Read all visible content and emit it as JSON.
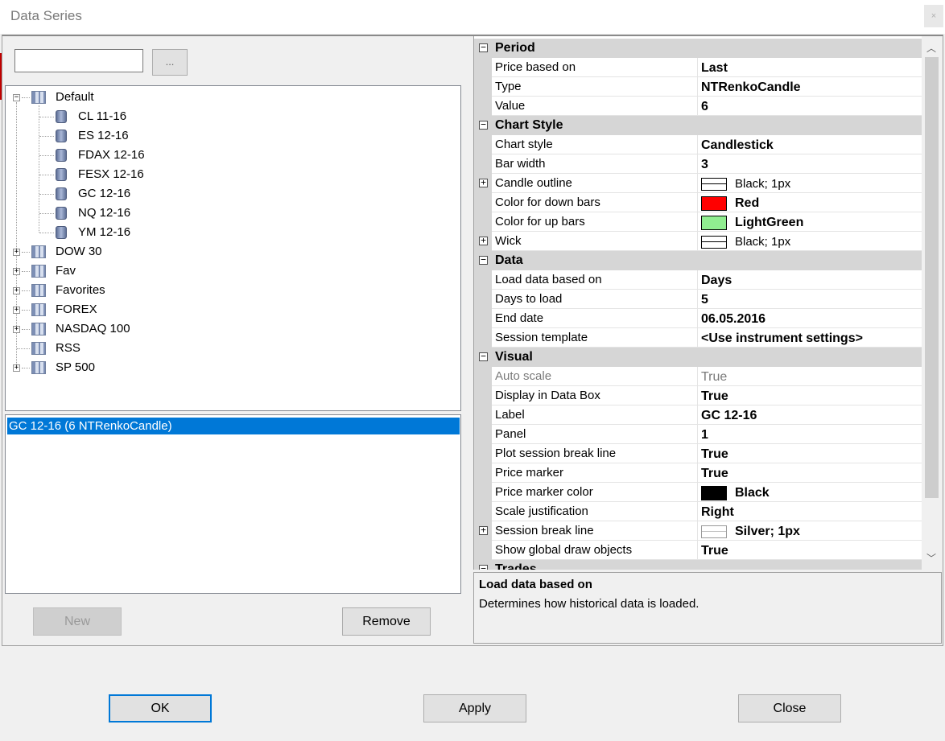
{
  "window": {
    "title": "Data Series",
    "close_glyph": "×"
  },
  "instrument_search": {
    "value": "",
    "browse_label": "..."
  },
  "tree": {
    "expanded": {
      "label": "Default",
      "children": [
        "CL 11-16",
        "ES 12-16",
        "FDAX 12-16",
        "FESX 12-16",
        "GC 12-16",
        "NQ 12-16",
        "YM 12-16"
      ]
    },
    "lists": [
      "DOW 30",
      "Fav",
      "Favorites",
      "FOREX",
      "NASDAQ 100",
      "RSS",
      "SP 500"
    ]
  },
  "series_list": {
    "selected": "GC 12-16 (6 NTRenkoCandle)"
  },
  "left_buttons": {
    "new": "New",
    "remove": "Remove"
  },
  "properties": {
    "period": {
      "title": "Period",
      "price_based_on": [
        "Price based on",
        "Last"
      ],
      "type": [
        "Type",
        "NTRenkoCandle"
      ],
      "value": [
        "Value",
        "6"
      ]
    },
    "chart_style": {
      "title": "Chart Style",
      "chart_style": [
        "Chart style",
        "Candlestick"
      ],
      "bar_width": [
        "Bar width",
        "3"
      ],
      "candle_outline": [
        "Candle outline",
        "Black; 1px"
      ],
      "down_color": [
        "Color for down bars",
        "Red",
        "#ff0000"
      ],
      "up_color": [
        "Color for up bars",
        "LightGreen",
        "#90ee90"
      ],
      "wick": [
        "Wick",
        "Black; 1px"
      ]
    },
    "data": {
      "title": "Data",
      "load_based_on": [
        "Load data based on",
        "Days"
      ],
      "days_to_load": [
        "Days to load",
        "5"
      ],
      "end_date": [
        "End date",
        "06.05.2016"
      ],
      "session_template": [
        "Session template",
        "<Use instrument settings>"
      ]
    },
    "visual": {
      "title": "Visual",
      "auto_scale": [
        "Auto scale",
        "True"
      ],
      "display_data_box": [
        "Display in Data Box",
        "True"
      ],
      "label": [
        "Label",
        "GC 12-16"
      ],
      "panel": [
        "Panel",
        "1"
      ],
      "plot_session_break": [
        "Plot session break line",
        "True"
      ],
      "price_marker": [
        "Price marker",
        "True"
      ],
      "price_marker_color": [
        "Price marker color",
        "Black",
        "#000000"
      ],
      "scale_justification": [
        "Scale justification",
        "Right"
      ],
      "session_break_line": [
        "Session break line",
        "Silver; 1px"
      ],
      "show_global_draw": [
        "Show global draw objects",
        "True"
      ]
    },
    "next_category": "Trades"
  },
  "help": {
    "title": "Load data based on",
    "description": "Determines how historical data is loaded."
  },
  "dialog_buttons": {
    "ok": "OK",
    "apply": "Apply",
    "close": "Close"
  }
}
